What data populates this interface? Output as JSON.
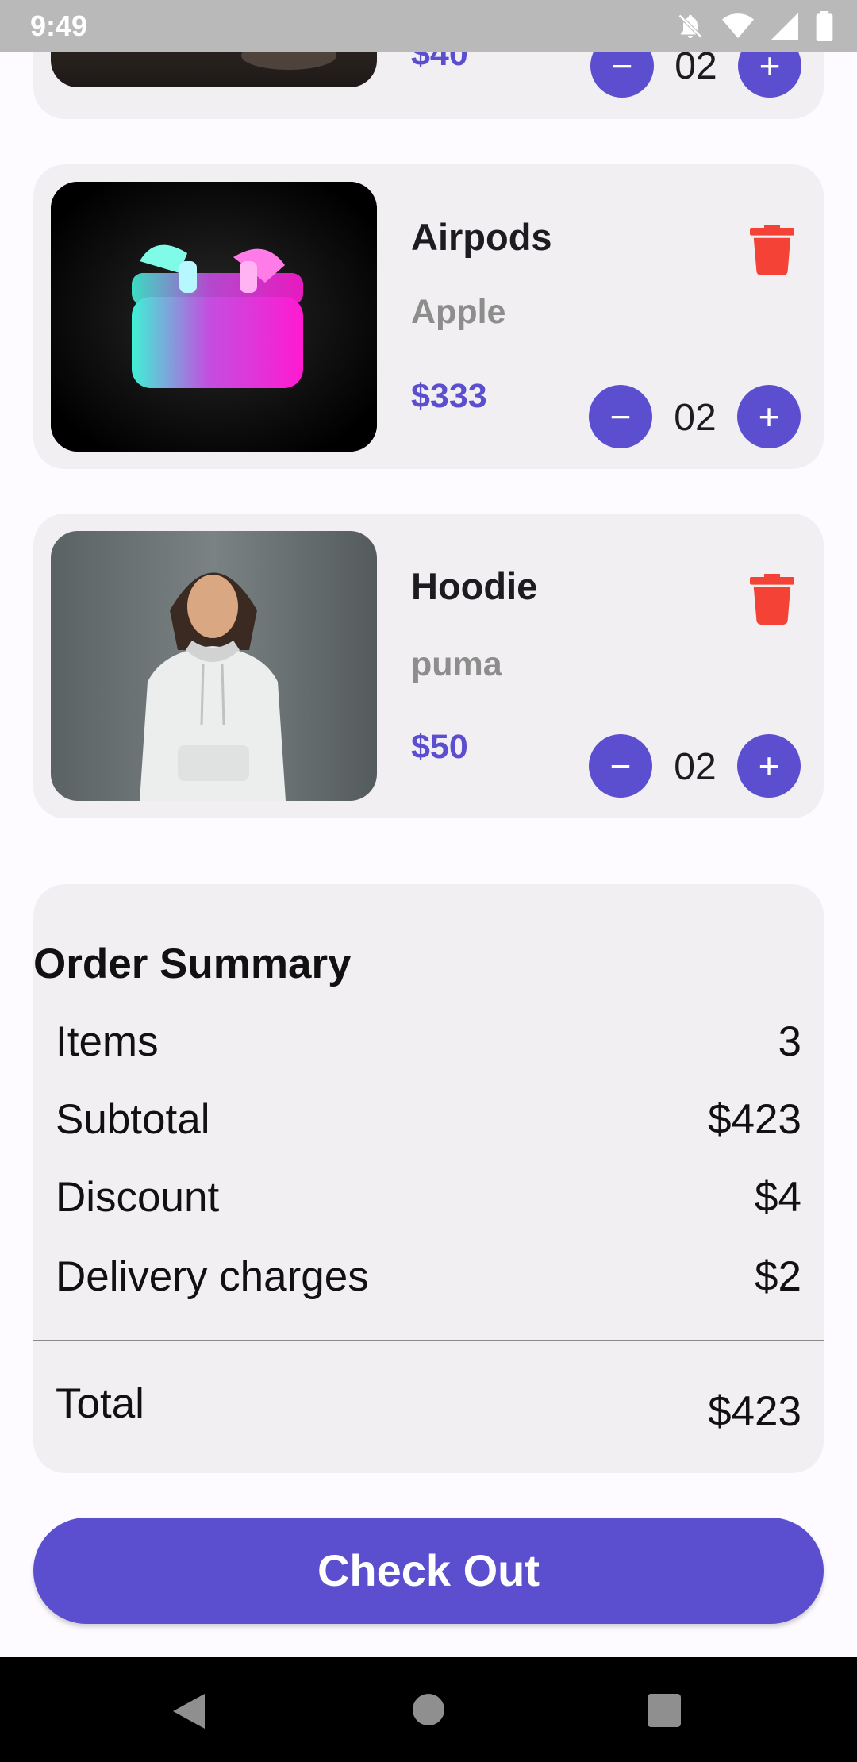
{
  "status_bar": {
    "time": "9:49"
  },
  "cart": {
    "items": [
      {
        "name": "",
        "brand": "",
        "price": "$40",
        "quantity": "02"
      },
      {
        "name": "Airpods",
        "brand": "Apple",
        "price": "$333",
        "quantity": "02"
      },
      {
        "name": "Hoodie",
        "brand": "puma",
        "price": "$50",
        "quantity": "02"
      }
    ],
    "decrement_symbol": "−",
    "increment_symbol": "+"
  },
  "summary": {
    "title": "Order Summary",
    "rows": [
      {
        "label": "Items",
        "value": "3"
      },
      {
        "label": "Subtotal",
        "value": "$423"
      },
      {
        "label": "Discount",
        "value": "$4"
      },
      {
        "label": "Delivery charges",
        "value": "$2"
      }
    ],
    "total_label": "Total",
    "total_value": "$423"
  },
  "checkout_label": "Check Out",
  "colors": {
    "accent": "#5b4fcf",
    "delete": "#f44336",
    "card": "#f2eff3"
  },
  "icons": [
    "delete-icon",
    "minus-icon",
    "plus-icon",
    "back-icon",
    "home-icon",
    "recents-icon"
  ]
}
